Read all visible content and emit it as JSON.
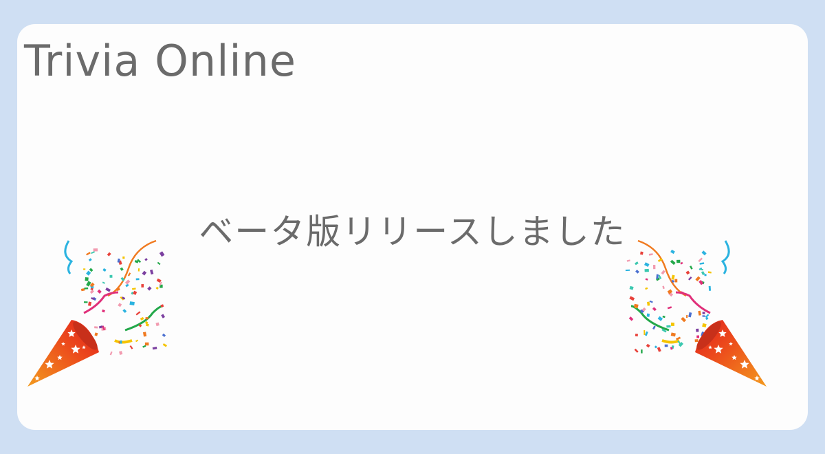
{
  "app": {
    "title": "Trivia Online"
  },
  "main": {
    "message": "ベータ版リリースしました"
  },
  "decorations": {
    "left_icon": "party-popper-icon",
    "right_icon": "party-popper-icon"
  },
  "colors": {
    "background": "#cfdff3",
    "card": "#fdfdfd",
    "text": "#6b6b6b"
  }
}
